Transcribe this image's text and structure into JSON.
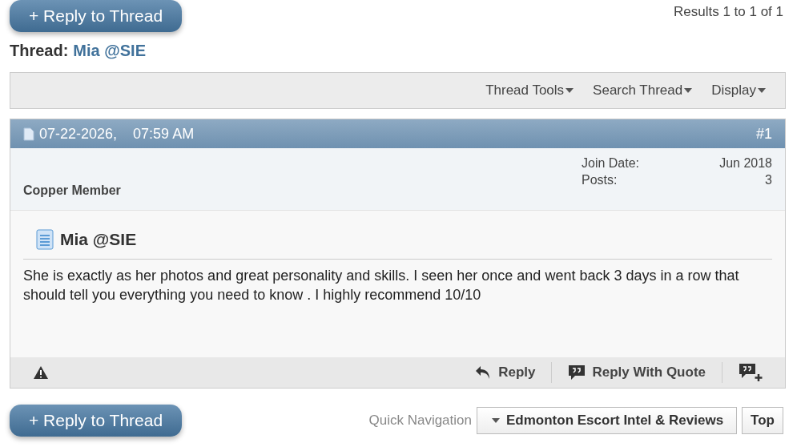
{
  "top_button": {
    "label": "+ Reply to Thread"
  },
  "results": "Results 1 to 1 of 1",
  "thread": {
    "prefix": "Thread:",
    "title": "Mia @SIE"
  },
  "toolbar": [
    "Thread Tools",
    "Search Thread",
    "Display"
  ],
  "post": {
    "date": "07-22-2026,",
    "time": "07:59 AM",
    "number": "#1",
    "user_title": "Copper Member",
    "stats": [
      {
        "label": "Join Date:",
        "value": "Jun 2018"
      },
      {
        "label": "Posts:",
        "value": "3"
      }
    ],
    "title": "Mia @SIE",
    "body": "She is exactly as her photos and great personality and skills. I seen her once and went back 3 days in a row that should tell you everything you need to know . I highly recommend 10/10",
    "actions": [
      "Reply",
      "Reply With Quote"
    ]
  },
  "bottom_button": {
    "label": "+ Reply to Thread"
  },
  "quick_nav": {
    "label": "Quick Navigation",
    "forum": "Edmonton Escort Intel & Reviews",
    "top": "Top"
  }
}
